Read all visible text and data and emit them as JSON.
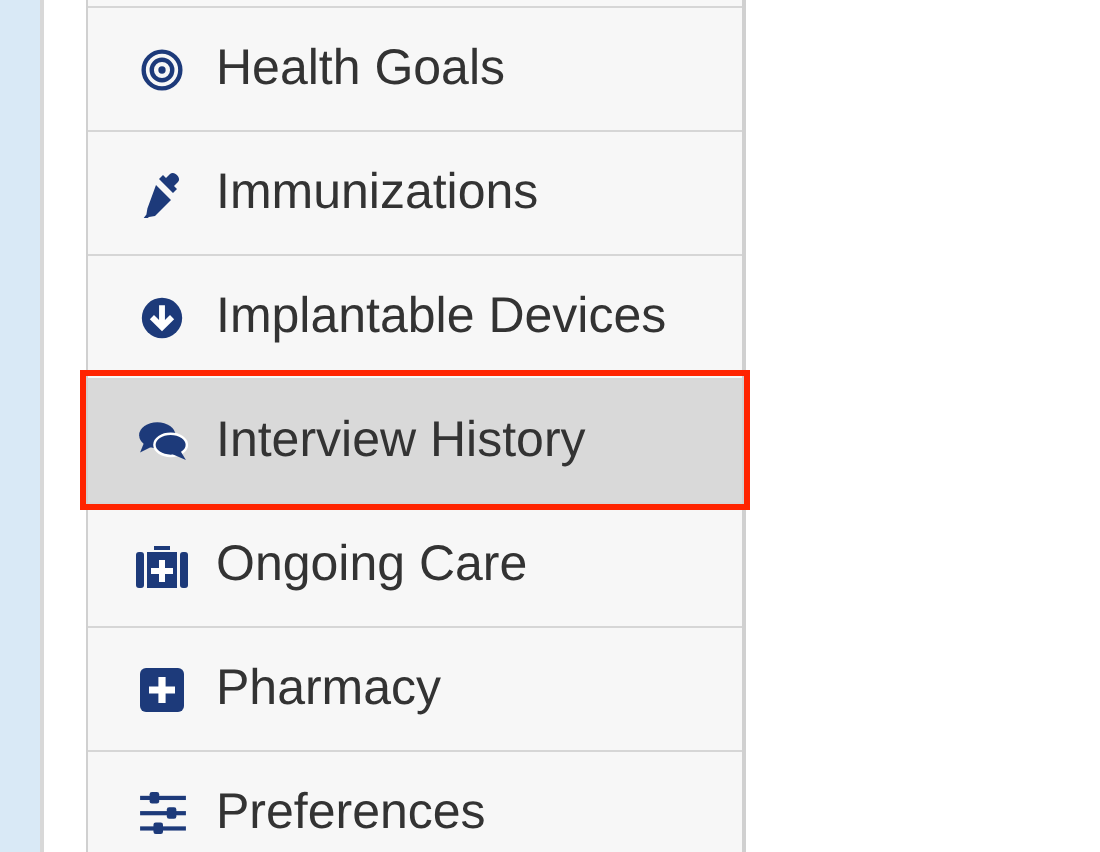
{
  "menu": {
    "items": [
      {
        "label": "Health Goals",
        "selected": false,
        "highlighted": false
      },
      {
        "label": "Immunizations",
        "selected": false,
        "highlighted": false
      },
      {
        "label": "Implantable Devices",
        "selected": false,
        "highlighted": false
      },
      {
        "label": "Interview History",
        "selected": true,
        "highlighted": true
      },
      {
        "label": "Ongoing Care",
        "selected": false,
        "highlighted": false
      },
      {
        "label": "Pharmacy",
        "selected": false,
        "highlighted": false
      },
      {
        "label": "Preferences",
        "selected": false,
        "highlighted": false
      }
    ]
  }
}
